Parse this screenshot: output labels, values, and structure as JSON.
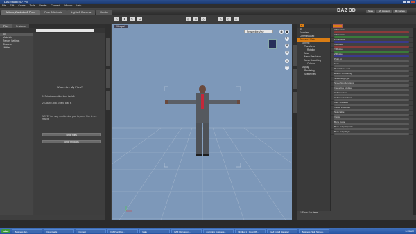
{
  "window": {
    "title": "DAZ Studio 4.7 Pro"
  },
  "menu": [
    "File",
    "Edit",
    "Create",
    "Tools",
    "Render",
    "Connect",
    "Window",
    "Help"
  ],
  "rooms": [
    "Actions, Wardrobe & Props",
    "Pose & Animate",
    "Lights & Cameras",
    "Render"
  ],
  "brand": {
    "logo_text": "DAZ 3D"
  },
  "top_buttons": [
    "Store",
    "My Account",
    "My Gallery"
  ],
  "left_panel": {
    "tabs": [
      "Files",
      "Products"
    ],
    "sidebar": [
      "All",
      "Materials",
      "Render Settings",
      "Shaders",
      "Utilities"
    ],
    "title": "Where Are My Files?",
    "step1": "1. Select a condition from the left.",
    "step2": "2. Double-click a file to load it.",
    "note": "NOTE: You may need to clear your keyword filter to see results.",
    "btn1": "Show Files",
    "btn2": "Show Products"
  },
  "viewport": {
    "tab": "Viewport",
    "camera": "Perspective View"
  },
  "scene": {
    "rows": [
      "All",
      "Favorites",
      "Currently Used",
      "Genesis 2 Male",
      "General",
      "Transforms",
      "Rotation",
      "Misc",
      "Mesh Resolution",
      "Mesh Smoothing",
      "Collision",
      "Display",
      "Rendering",
      "Scene View"
    ],
    "show_sub_items": "Show Sub Items"
  },
  "params": [
    {
      "label": "X Translate",
      "color": "#b33"
    },
    {
      "label": "Y Translate",
      "color": "#3a3"
    },
    {
      "label": "Z Translate",
      "color": "#33b"
    },
    {
      "label": "X Rotate",
      "color": "#b33"
    },
    {
      "label": "Y Rotate",
      "color": "#3a3"
    },
    {
      "label": "Z Rotate",
      "color": "#33b"
    },
    {
      "label": "Point At",
      "color": "#5a5a5a"
    },
    {
      "label": "Fit to",
      "color": "#5a5a5a"
    },
    {
      "label": "Resolution Level",
      "color": "#5a5a5a"
    },
    {
      "label": "Enable Smoothing",
      "color": "#5a5a5a"
    },
    {
      "label": "Smoothing Type",
      "color": "#5a5a5a"
    },
    {
      "label": "Smoothing Iterations",
      "color": "#5a5a5a"
    },
    {
      "label": "Interactive Update",
      "color": "#5a5a5a"
    },
    {
      "label": "Collision Item",
      "color": "#5a5a5a"
    },
    {
      "label": "Collision Iterations",
      "color": "#5a5a5a"
    },
    {
      "label": "Cast Shadows",
      "color": "#5a5a5a"
    },
    {
      "label": "Visible in Render",
      "color": "#5a5a5a"
    },
    {
      "label": "Selectable",
      "color": "#5a5a5a"
    },
    {
      "label": "Visible",
      "color": "#5a5a5a"
    },
    {
      "label": "Bone Color",
      "color": "#5a5a5a"
    },
    {
      "label": "Bone Edge Opacity",
      "color": "#5a5a5a"
    },
    {
      "label": "Bone Edge Style",
      "color": "#5a5a5a"
    }
  ],
  "taskbar": {
    "start": "start",
    "items": [
      "Business Sui...",
      "Downloads",
      "Content",
      "DMDSandbox...",
      "Male",
      "DAZ Discussion...",
      "morphing_business...",
      "Untitled 1 - OpenOffi...",
      "DAZ Install Manager",
      "Business_Suit_Screen..."
    ],
    "clock": "3:05 AM"
  }
}
